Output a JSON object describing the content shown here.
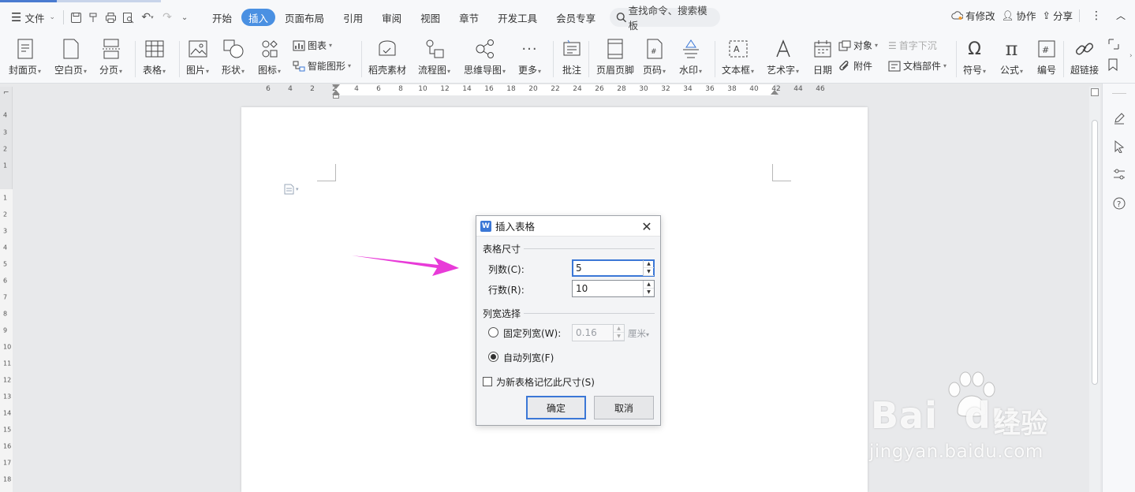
{
  "menubar": {
    "file_label": "文件",
    "tabs": [
      {
        "label": "开始",
        "active": false
      },
      {
        "label": "插入",
        "active": true
      },
      {
        "label": "页面布局",
        "active": false
      },
      {
        "label": "引用",
        "active": false
      },
      {
        "label": "审阅",
        "active": false
      },
      {
        "label": "视图",
        "active": false
      },
      {
        "label": "章节",
        "active": false
      },
      {
        "label": "开发工具",
        "active": false
      },
      {
        "label": "会员专享",
        "active": false
      }
    ],
    "search_label": "查找命令、搜索模板",
    "right": {
      "modified_label": "有修改",
      "collab_label": "协作",
      "share_label": "分享"
    }
  },
  "ribbon": {
    "cover_page": "封面页",
    "blank_page": "空白页",
    "page_break": "分页",
    "table": "表格",
    "picture": "图片",
    "shape": "形状",
    "icons": "图标",
    "chart": "图表",
    "smart_art": "智能图形",
    "docer_material": "稻壳素材",
    "flowchart": "流程图",
    "mindmap": "思维导图",
    "more": "更多",
    "comment": "批注",
    "header_footer": "页眉页脚",
    "page_number": "页码",
    "watermark": "水印",
    "textbox": "文本框",
    "wordart": "艺术字",
    "date": "日期",
    "object": "对象",
    "drop_cap": "首字下沉",
    "attachment": "附件",
    "doc_parts": "文档部件",
    "symbol": "符号",
    "formula": "公式",
    "numbering": "编号",
    "hyperlink": "超链接"
  },
  "ruler": {
    "h_ticks": [
      "6",
      "4",
      "2",
      "2",
      "4",
      "6",
      "8",
      "10",
      "12",
      "14",
      "16",
      "18",
      "20",
      "22",
      "24",
      "26",
      "28",
      "30",
      "32",
      "34",
      "36",
      "38",
      "40",
      "42",
      "44",
      "46"
    ],
    "v_ticks": [
      "4",
      "3",
      "2",
      "1",
      "1",
      "2",
      "3",
      "4",
      "5",
      "6",
      "7",
      "8",
      "9",
      "10",
      "11",
      "12",
      "13",
      "14",
      "15",
      "16",
      "17",
      "18"
    ]
  },
  "dialog": {
    "title": "插入表格",
    "group_size": "表格尺寸",
    "columns_label": "列数(C):",
    "columns_value": "5",
    "rows_label": "行数(R):",
    "rows_value": "10",
    "group_width": "列宽选择",
    "fixed_width_label": "固定列宽(W):",
    "fixed_width_value": "0.16",
    "fixed_width_unit": "厘米",
    "auto_width_label": "自动列宽(F)",
    "remember_label": "为新表格记忆此尺寸(S)",
    "ok_label": "确定",
    "cancel_label": "取消"
  },
  "watermark": {
    "brand": "Bai",
    "brand2": "du",
    "jingyan": "经验",
    "url": "jingyan.baidu.com"
  },
  "colors": {
    "accent": "#4a90e2",
    "arrow": "#e83bd8",
    "dialog_focus": "#3b77d6"
  }
}
